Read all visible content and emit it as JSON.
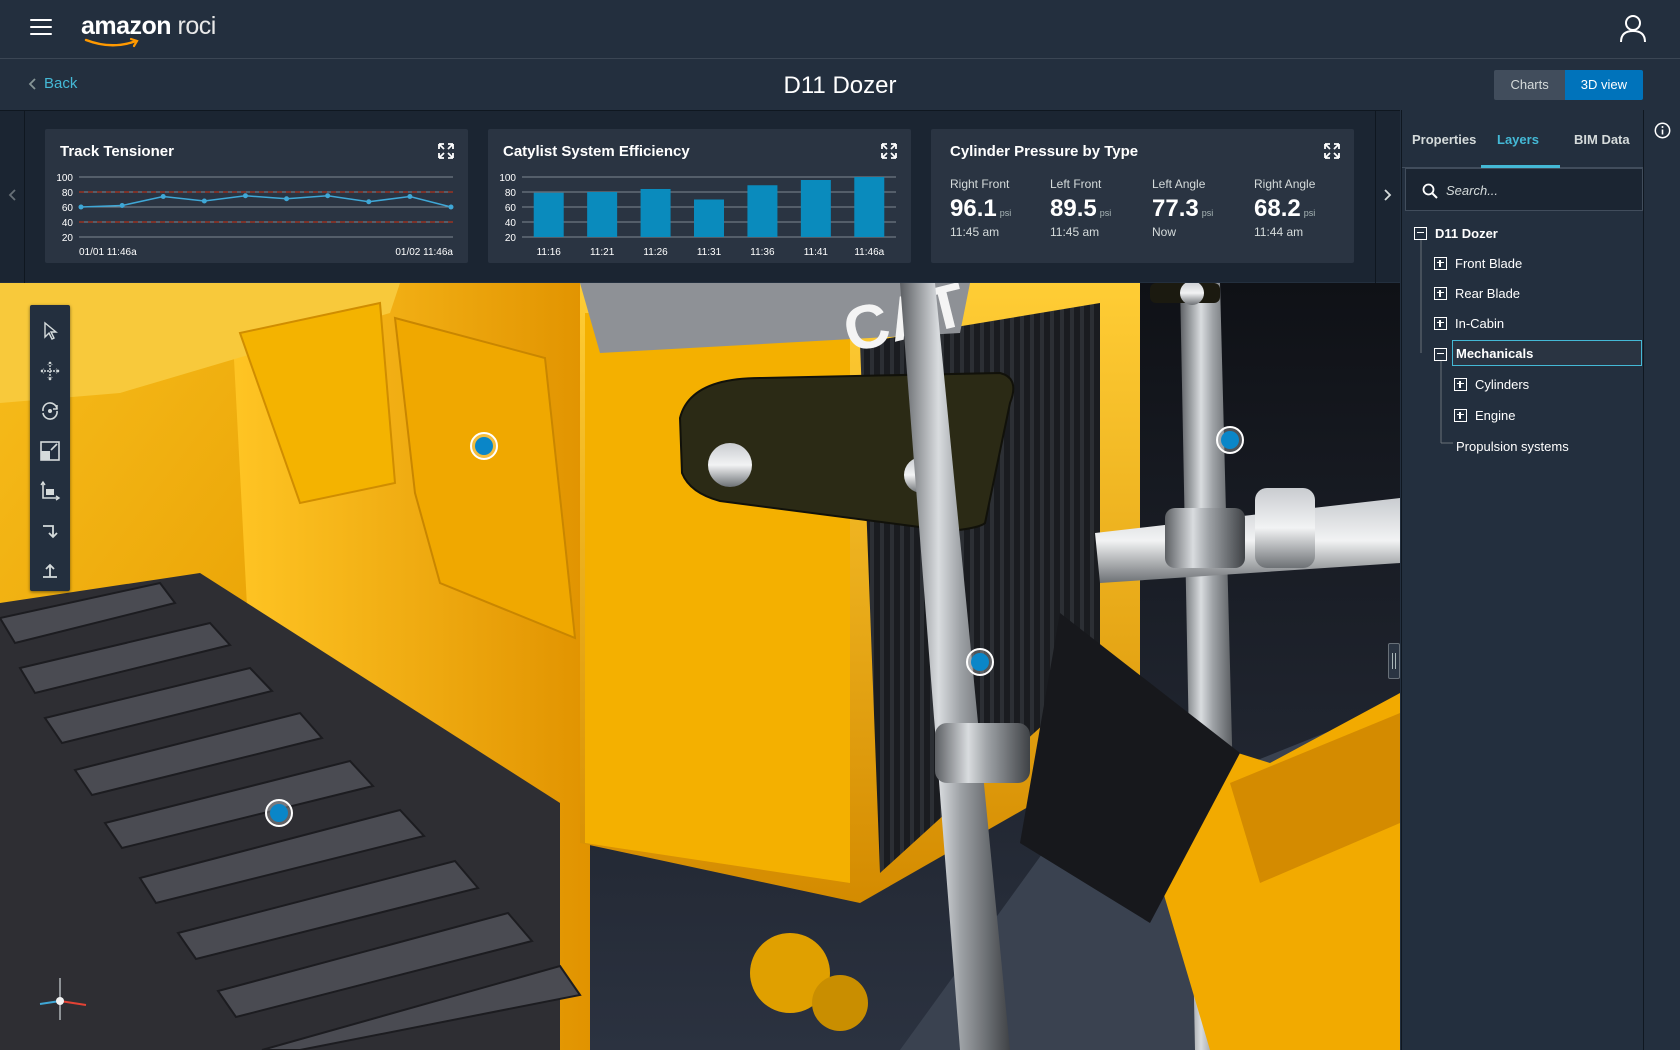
{
  "header": {
    "logo_brand": "amazon",
    "logo_product": "roci",
    "back_label": "Back",
    "page_title": "D11 Dozer",
    "view_toggle": {
      "charts_label": "Charts",
      "view3d_label": "3D view",
      "selected": "3D view"
    }
  },
  "cards": {
    "track": {
      "title": "Track Tensioner",
      "x_start": "01/01 11:46a",
      "x_end": "01/02 11:46a"
    },
    "efficiency": {
      "title": "Catylist System Efficiency"
    },
    "pressure": {
      "title": "Cylinder Pressure by Type",
      "metrics": [
        {
          "label": "Right Front",
          "value": "96.1",
          "unit": "psi",
          "time": "11:45 am"
        },
        {
          "label": "Left Front",
          "value": "89.5",
          "unit": "psi",
          "time": "11:45 am"
        },
        {
          "label": "Left Angle",
          "value": "77.3",
          "unit": "psi",
          "time": "Now"
        },
        {
          "label": "Right Angle",
          "value": "68.2",
          "unit": "psi",
          "time": "11:44 am"
        }
      ]
    }
  },
  "chart_data": [
    {
      "type": "line",
      "title": "Track Tensioner",
      "ylim": [
        20,
        100
      ],
      "yticks": [
        100,
        80,
        60,
        40,
        20
      ],
      "x_labels": [
        "01/01 11:46a",
        "01/02 11:46a"
      ],
      "threshold_lines": [
        80,
        40
      ],
      "series": [
        {
          "values": [
            60,
            62,
            74,
            68,
            75,
            71,
            75,
            67,
            74,
            60
          ]
        }
      ],
      "color": "#3fa7d6"
    },
    {
      "type": "bar",
      "title": "Catylist System Efficiency",
      "ylim": [
        20,
        100
      ],
      "yticks": [
        100,
        80,
        60,
        40,
        20
      ],
      "categories": [
        "11:16",
        "11:21",
        "11:26",
        "11:31",
        "11:36",
        "11:41",
        "11:46a"
      ],
      "values": [
        79,
        80,
        84,
        70,
        89,
        96,
        100
      ],
      "color": "#0a8bbd"
    }
  ],
  "panel": {
    "tabs": [
      "Properties",
      "Layers",
      "BIM Data"
    ],
    "active_tab": "Layers",
    "search_placeholder": "Search...",
    "tree": [
      {
        "label": "D11 Dozer",
        "level": 0,
        "state": "expanded"
      },
      {
        "label": "Front Blade",
        "level": 1,
        "state": "collapsed"
      },
      {
        "label": "Rear Blade",
        "level": 1,
        "state": "collapsed"
      },
      {
        "label": "In-Cabin",
        "level": 1,
        "state": "collapsed"
      },
      {
        "label": "Mechanicals",
        "level": 1,
        "state": "expanded",
        "selected": true
      },
      {
        "label": "Cylinders",
        "level": 2,
        "state": "collapsed"
      },
      {
        "label": "Engine",
        "level": 2,
        "state": "collapsed"
      },
      {
        "label": "Propulsion systems",
        "level": 2,
        "state": "leaf"
      }
    ]
  },
  "viewport": {
    "tools": [
      "select-tool",
      "pan-tool",
      "orbit-tool",
      "zoom-extents-tool",
      "frame-tool",
      "step-down-tool",
      "step-up-tool"
    ],
    "model_text": "CAT",
    "colors": {
      "accent": "#0073bb",
      "machine": "#f2b300",
      "poi": "#0a86c8"
    }
  }
}
